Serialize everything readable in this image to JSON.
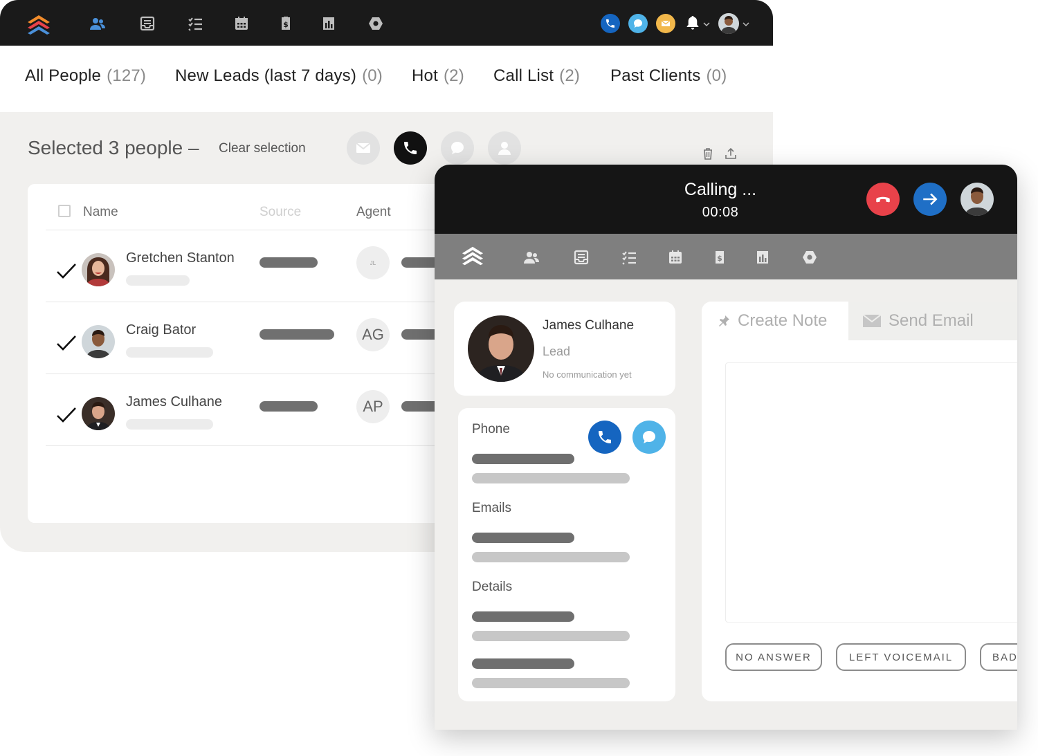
{
  "topnav": {
    "icons": [
      "logo-icon",
      "people-icon",
      "inbox-icon",
      "tasks-icon",
      "calendar-icon",
      "deals-icon",
      "reports-icon",
      "settings-icon"
    ],
    "right_icons": [
      "phone-icon",
      "chat-icon",
      "email-icon",
      "bell-icon",
      "user-avatar"
    ],
    "colors": {
      "phone": "#1565c0",
      "chat": "#4fb3e8",
      "email": "#f2b84b",
      "people": "#4a90d9"
    }
  },
  "tabs": [
    {
      "label": "All People",
      "count": "(127)"
    },
    {
      "label": "New Leads (last 7 days)",
      "count": "(0)"
    },
    {
      "label": "Hot",
      "count": "(2)"
    },
    {
      "label": "Call List",
      "count": "(2)"
    },
    {
      "label": "Past Clients",
      "count": "(0)"
    }
  ],
  "selection": {
    "title": "Selected 3 people –",
    "clear_label": "Clear selection"
  },
  "table": {
    "headers": {
      "name": "Name",
      "source": "Source",
      "agent": "Agent"
    },
    "rows": [
      {
        "name": "Gretchen Stanton",
        "agent": "JL",
        "checked": true
      },
      {
        "name": "Craig Bator",
        "agent": "AG",
        "checked": true
      },
      {
        "name": "James Culhane",
        "agent": "AP",
        "checked": true
      }
    ]
  },
  "call": {
    "status": "Calling ...",
    "timer": "00:08",
    "colors": {
      "hangup": "#e8424a",
      "transfer": "#1f6fc6"
    }
  },
  "contact": {
    "name": "James Culhane",
    "stage": "Lead",
    "communication": "No communication yet"
  },
  "info": {
    "phone_label": "Phone",
    "emails_label": "Emails",
    "details_label": "Details"
  },
  "note": {
    "create_tab": "Create Note",
    "email_tab": "Send Email"
  },
  "outcomes": [
    "NO ANSWER",
    "LEFT VOICEMAIL",
    "BAD"
  ]
}
